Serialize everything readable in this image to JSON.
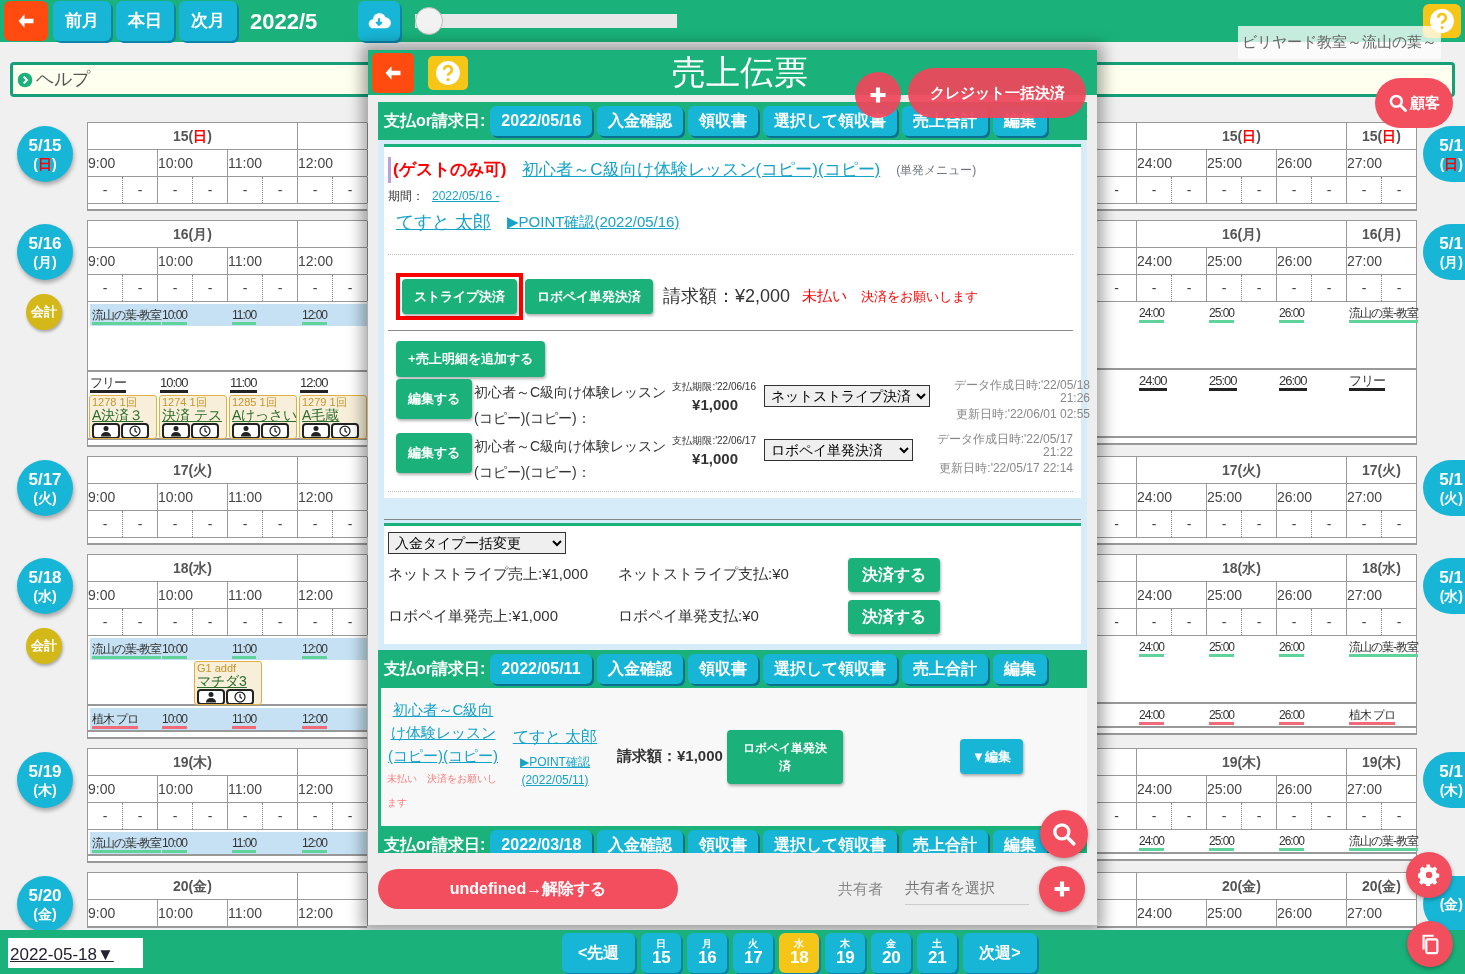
{
  "topbar": {
    "nav_buttons": [
      "前月",
      "本日",
      "次月"
    ],
    "month": "2022/5",
    "slider": {
      "level": 0
    },
    "shop_name": "ビリヤード教室～流山の葉～"
  },
  "help": {
    "label": "ヘルプ"
  },
  "customer_button": "顧客",
  "days": [
    {
      "bubble": {
        "date": "5/15",
        "pre": "(",
        "wd": "日",
        "post": ")",
        "red": true
      },
      "left_header": {
        "pre": "15(",
        "wd": "日",
        "post": ")",
        "red": true
      },
      "right_headers": [
        {
          "pre": "15(",
          "wd": "日",
          "post": ")",
          "red": true
        },
        {
          "pre": "15(",
          "wd": "日",
          "post": ")",
          "red": true
        }
      ],
      "left_times": [
        "9:00",
        "10:00",
        "11:00",
        "12:00"
      ],
      "right_times": [
        "24:00",
        "25:00",
        "26:00",
        "27:00"
      ],
      "left_slots": [
        "-",
        "-",
        "-",
        "-",
        "-",
        "-",
        "-",
        "-"
      ],
      "right_slots": [
        "-",
        "-",
        "-",
        "-",
        "-",
        "-",
        "-",
        "-",
        "-"
      ],
      "right_bubble": {
        "date": "5/1",
        "pre": "(",
        "wd": "日",
        "post": ")",
        "red": true
      }
    },
    {
      "bubble": {
        "date": "5/16",
        "pre": "(",
        "wd": "月",
        "post": ")",
        "red": false
      },
      "accounting": "会計",
      "left_header": {
        "pre": "16(",
        "wd": "月",
        "post": ")",
        "red": false
      },
      "right_headers": [
        {
          "pre": "16(",
          "wd": "月",
          "post": ")",
          "red": false
        },
        {
          "pre": "16(",
          "wd": "月",
          "post": ")",
          "red": false
        }
      ],
      "left_times": [
        "9:00",
        "10:00",
        "11:00",
        "12:00"
      ],
      "right_times": [
        "24:00",
        "25:00",
        "26:00",
        "27:00"
      ],
      "left_slots": [
        "-",
        "-",
        "-",
        "-",
        "-",
        "-",
        "-",
        "-"
      ],
      "right_slots": [
        "-",
        "-",
        "-",
        "-",
        "-",
        "-",
        "-",
        "-",
        "-"
      ],
      "lanes": [
        {
          "kind": "bar-tall",
          "color": "#5fd39a",
          "left": [
            "流山の葉-教室",
            "10:00",
            "11:00",
            "12:00"
          ],
          "right": [
            "24:00",
            "25:00",
            "26:00",
            "流山の葉-教室"
          ]
        },
        {
          "kind": "plain",
          "color": "#222222",
          "left": [
            "フリー",
            "10:00",
            "11:00",
            "12:00"
          ],
          "right": [
            "24:00",
            "25:00",
            "26:00",
            "フリー"
          ],
          "slots": [
            {
              "kind": "booking",
              "code": "1278 1回",
              "title": "A決済３"
            },
            {
              "kind": "booking",
              "code": "1274 1回",
              "title": "決済 テス"
            },
            {
              "kind": "booking",
              "code": "1285 1回",
              "title": "Aけっさい"
            },
            {
              "kind": "booking",
              "code": "1279 1回",
              "title": "A毛蔵"
            }
          ]
        }
      ],
      "right_bubble": {
        "date": "5/1",
        "pre": "(",
        "wd": "月",
        "post": ")",
        "red": false
      }
    },
    {
      "bubble": {
        "date": "5/17",
        "pre": "(",
        "wd": "火",
        "post": ")",
        "red": false
      },
      "left_header": {
        "pre": "17(",
        "wd": "火",
        "post": ")",
        "red": false
      },
      "right_headers": [
        {
          "pre": "17(",
          "wd": "火",
          "post": ")",
          "red": false
        },
        {
          "pre": "17(",
          "wd": "火",
          "post": ")",
          "red": false
        }
      ],
      "left_times": [
        "9:00",
        "10:00",
        "11:00",
        "12:00"
      ],
      "right_times": [
        "24:00",
        "25:00",
        "26:00",
        "27:00"
      ],
      "left_slots": [
        "-",
        "-",
        "-",
        "-",
        "-",
        "-",
        "-",
        "-"
      ],
      "right_slots": [
        "-",
        "-",
        "-",
        "-",
        "-",
        "-",
        "-",
        "-",
        "-"
      ],
      "right_bubble": {
        "date": "5/1",
        "pre": "(",
        "wd": "火",
        "post": ")",
        "red": false
      }
    },
    {
      "bubble": {
        "date": "5/18",
        "pre": "(",
        "wd": "水",
        "post": ")",
        "red": false
      },
      "accounting": "会計",
      "left_header": {
        "pre": "18(",
        "wd": "水",
        "post": ")",
        "red": false
      },
      "right_headers": [
        {
          "pre": "18(",
          "wd": "水",
          "post": ")",
          "red": false
        },
        {
          "pre": "18(",
          "wd": "水",
          "post": ")",
          "red": false
        }
      ],
      "left_times": [
        "9:00",
        "10:00",
        "11:00",
        "12:00"
      ],
      "right_times": [
        "24:00",
        "25:00",
        "26:00",
        "27:00"
      ],
      "left_slots": [
        "-",
        "-",
        "-",
        "-",
        "-",
        "-",
        "-",
        "-"
      ],
      "right_slots": [
        "-",
        "-",
        "-",
        "-",
        "-",
        "-",
        "-",
        "-",
        "-"
      ],
      "lanes": [
        {
          "kind": "bar-tall",
          "color": "#5fd39a",
          "left": [
            "流山の葉-教室",
            "10:00",
            "11:00",
            "12:00"
          ],
          "right": [
            "24:00",
            "25:00",
            "26:00",
            "流山の葉-教室"
          ],
          "slots": [
            {
              "kind": "empty"
            },
            {
              "kind": "empty"
            },
            {
              "kind": "empty"
            },
            {
              "kind": "booking",
              "code": "G1 addf",
              "title": "マチダ3"
            }
          ]
        },
        {
          "kind": "bar",
          "color": "#f06a7a",
          "left": [
            "植木 プロ",
            "10:00",
            "11:00",
            "12:00"
          ],
          "right": [
            "24:00",
            "25:00",
            "26:00",
            "植木 プロ"
          ]
        }
      ],
      "right_bubble": {
        "date": "5/1",
        "pre": "(",
        "wd": "水",
        "post": ")",
        "red": false
      }
    },
    {
      "bubble": {
        "date": "5/19",
        "pre": "(",
        "wd": "木",
        "post": ")",
        "red": false
      },
      "left_header": {
        "pre": "19(",
        "wd": "木",
        "post": ")",
        "red": false
      },
      "right_headers": [
        {
          "pre": "19(",
          "wd": "木",
          "post": ")",
          "red": false
        },
        {
          "pre": "19(",
          "wd": "木",
          "post": ")",
          "red": false
        }
      ],
      "left_times": [
        "9:00",
        "10:00",
        "11:00",
        "12:00"
      ],
      "right_times": [
        "24:00",
        "25:00",
        "26:00",
        "27:00"
      ],
      "left_slots": [
        "-",
        "-",
        "-",
        "-",
        "-",
        "-",
        "-",
        "-"
      ],
      "right_slots": [
        "-",
        "-",
        "-",
        "-",
        "-",
        "-",
        "-",
        "-",
        "-"
      ],
      "lanes": [
        {
          "kind": "bar",
          "color": "#5fd39a",
          "left": [
            "流山の葉-教室",
            "10:00",
            "11:00",
            "12:00"
          ],
          "right": [
            "24:00",
            "25:00",
            "26:00",
            "流山の葉-教室"
          ]
        }
      ],
      "right_bubble": {
        "date": "5/1",
        "pre": "(",
        "wd": "木",
        "post": ")",
        "red": false
      }
    },
    {
      "bubble": {
        "date": "5/20",
        "pre": "(",
        "wd": "金",
        "post": ")",
        "red": false
      },
      "left_header": {
        "pre": "20(",
        "wd": "金",
        "post": ")",
        "red": false
      },
      "right_headers": [
        {
          "pre": "20(",
          "wd": "金",
          "post": ")",
          "red": false
        },
        {
          "pre": "20(",
          "wd": "金",
          "post": ")",
          "red": false
        }
      ],
      "left_times": [
        "9:00",
        "10:00",
        "11:00",
        "12:00"
      ],
      "right_times": [
        "24:00",
        "25:00",
        "26:00",
        "27:00"
      ],
      "right_bubble": {
        "pre": "(",
        "wd": "金",
        "post": ")",
        "red": false
      }
    }
  ],
  "modal": {
    "title": "売上伝票",
    "credit_button": "クレジット一括決済",
    "invoices": [
      {
        "kind": "expanded",
        "label": "支払or請求日:",
        "date": "2022/05/16",
        "actions": [
          "入金確認",
          "領収書",
          "選択して領収書",
          "売上合計",
          "編集"
        ],
        "tag": "(ゲストのみ可)",
        "course": "初心者～C級向け体験レッスン(コピー)(コピー)",
        "menu_type": "(単発メニュー)",
        "period_label": "期間：",
        "period": "2022/05/16 -",
        "customer": "てすと 太郎",
        "point": "▶POINT確認(2022/05/16)",
        "pay_buttons": [
          {
            "label": "ストライプ決済",
            "highlighted": true
          },
          {
            "label": "ロボペイ単発決済",
            "highlighted": false
          }
        ],
        "amount": "請求額：¥2,000",
        "status": "未払い",
        "notice": "決済をお願いします",
        "add_button": "+売上明細を追加する",
        "items": [
          {
            "edit": "編集する",
            "name": "初心者～C級向け体験レッスン(コピー)(コピー)：",
            "due": "支払期限:'22/06/16",
            "price": "¥1,000",
            "method": "ネットストライプ決済",
            "created": "データ作成日時:'22/05/18 21:26",
            "updated": "更新日時:'22/06/01 02:55"
          },
          {
            "edit": "編集する",
            "name": "初心者～C級向け体験レッスン(コピー)(コピー)：",
            "due": "支払期限:'22/06/17",
            "price": "¥1,000",
            "method": "ロボペイ単発決済",
            "created": "データ作成日時:'22/05/17 21:22",
            "updated": "更新日時:'22/05/17 22:14"
          }
        ],
        "bulk_select": "入金タイプ一括変更",
        "settlements": [
          {
            "sales": "ネットストライプ売上:¥1,000",
            "paid": "ネットストライプ支払:¥0",
            "button": "決済する"
          },
          {
            "sales": "ロボペイ単発売上:¥1,000",
            "paid": "ロボペイ単発支払:¥0",
            "button": "決済する"
          }
        ]
      },
      {
        "kind": "compact",
        "label": "支払or請求日:",
        "date": "2022/05/11",
        "actions": [
          "入金確認",
          "領収書",
          "選択して領収書",
          "売上合計",
          "編集"
        ],
        "course": "初心者～C級向け体験レッスン(コピー)(コピー)",
        "note": "未払い　決済をお願いします",
        "customer": "てすと 太郎",
        "point": "▶POINT確認(2022/05/11)",
        "amount": "請求額：¥1,000",
        "pay_button": "ロボペイ単発決済",
        "edit_button": "▼編集"
      },
      {
        "kind": "header",
        "label": "支払or請求日:",
        "date": "2022/03/18",
        "actions": [
          "入金確認",
          "領収書",
          "選択して領収書",
          "売上合計",
          "編集"
        ]
      }
    ],
    "release_button": "undefined→解除する",
    "sharer_label": "共有者",
    "sharer_placeholder": "共有者を選択"
  },
  "bottom": {
    "date": "2022-05-18▼",
    "prev": "<先週",
    "next": "次週>",
    "week": [
      {
        "weekday": "日",
        "day": "15",
        "selected": false
      },
      {
        "weekday": "月",
        "day": "16",
        "selected": false
      },
      {
        "weekday": "火",
        "day": "17",
        "selected": false
      },
      {
        "weekday": "水",
        "day": "18",
        "selected": true
      },
      {
        "weekday": "木",
        "day": "19",
        "selected": false
      },
      {
        "weekday": "金",
        "day": "20",
        "selected": false
      },
      {
        "weekday": "土",
        "day": "21",
        "selected": false
      }
    ]
  }
}
